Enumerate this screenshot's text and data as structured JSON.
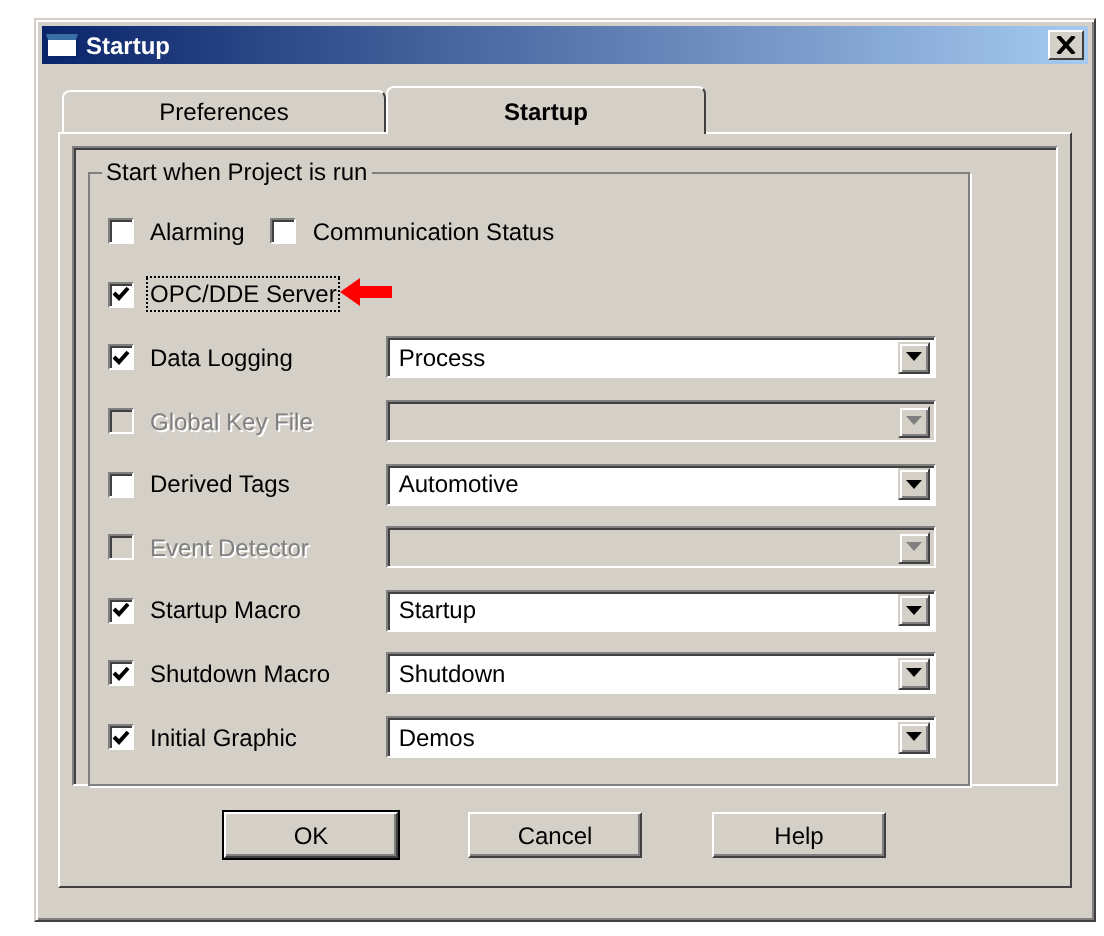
{
  "window": {
    "title": "Startup"
  },
  "tabs": [
    {
      "label": "Preferences",
      "selected": false
    },
    {
      "label": "Startup",
      "selected": true
    }
  ],
  "group": {
    "title": "Start when Project is run"
  },
  "rows": [
    {
      "checks": [
        {
          "label": "Alarming",
          "checked": false,
          "disabled": false,
          "focused": false,
          "pointed": false
        },
        {
          "label": "Communication Status",
          "checked": false,
          "disabled": false,
          "focused": false,
          "pointed": false
        }
      ]
    },
    {
      "checks": [
        {
          "label": "OPC/DDE Server",
          "checked": true,
          "disabled": false,
          "focused": true,
          "pointed": true
        }
      ]
    },
    {
      "checks": [
        {
          "label": "Data Logging",
          "checked": true,
          "disabled": false,
          "focused": false,
          "pointed": false
        }
      ],
      "combo": {
        "value": "Process",
        "disabled": false
      }
    },
    {
      "checks": [
        {
          "label": "Global Key File",
          "checked": false,
          "disabled": true,
          "focused": false,
          "pointed": false
        }
      ],
      "combo": {
        "disabled": true
      }
    },
    {
      "checks": [
        {
          "label": "Derived Tags",
          "checked": false,
          "disabled": false,
          "focused": false,
          "pointed": false
        }
      ],
      "combo": {
        "value": "Automotive",
        "disabled": false
      }
    },
    {
      "checks": [
        {
          "label": "Event Detector",
          "checked": false,
          "disabled": true,
          "focused": false,
          "pointed": false
        }
      ],
      "combo": {
        "disabled": true
      }
    },
    {
      "checks": [
        {
          "label": "Startup Macro",
          "checked": true,
          "disabled": false,
          "focused": false,
          "pointed": false
        }
      ],
      "combo": {
        "value": "Startup",
        "disabled": false
      }
    },
    {
      "checks": [
        {
          "label": "Shutdown Macro",
          "checked": true,
          "disabled": false,
          "focused": false,
          "pointed": false
        }
      ],
      "combo": {
        "value": "Shutdown",
        "disabled": false
      }
    },
    {
      "checks": [
        {
          "label": "Initial Graphic",
          "checked": true,
          "disabled": false,
          "focused": false,
          "pointed": false
        }
      ],
      "combo": {
        "value": "Demos",
        "disabled": false
      }
    }
  ],
  "buttons": [
    "OK",
    "Cancel",
    "Help"
  ]
}
